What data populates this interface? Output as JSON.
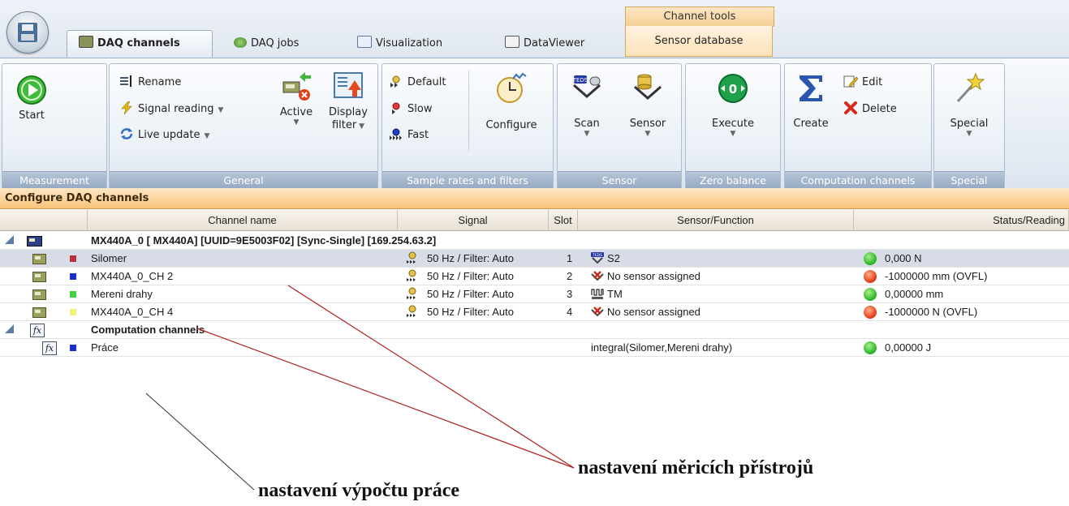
{
  "tabs": {
    "context_header": "Channel tools",
    "items": [
      {
        "label": "DAQ channels"
      },
      {
        "label": "DAQ jobs"
      },
      {
        "label": "Visualization"
      },
      {
        "label": "DataViewer"
      },
      {
        "label": "Sensor database"
      }
    ]
  },
  "ribbon": {
    "measurement": {
      "label": "Measurement",
      "start": "Start"
    },
    "general": {
      "label": "General",
      "rename": "Rename",
      "signal_reading": "Signal reading",
      "live_update": "Live update",
      "active": "Active",
      "display_filter_1": "Display",
      "display_filter_2": "filter"
    },
    "sample_rates": {
      "label": "Sample rates and filters",
      "default": "Default",
      "slow": "Slow",
      "fast": "Fast",
      "configure": "Configure"
    },
    "sensor": {
      "label": "Sensor",
      "scan": "Scan",
      "sensor": "Sensor"
    },
    "zero_balance": {
      "label": "Zero balance",
      "execute": "Execute"
    },
    "computation": {
      "label": "Computation channels",
      "create": "Create",
      "edit": "Edit",
      "delete": "Delete"
    },
    "special": {
      "label": "Special",
      "special": "Special"
    }
  },
  "section_title": "Configure DAQ channels",
  "columns": {
    "channel_name": "Channel name",
    "signal": "Signal",
    "slot": "Slot",
    "sensor_function": "Sensor/Function",
    "status": "Status/Reading"
  },
  "device_group": {
    "title": "MX440A_0   [ MX440A] [UUID=9E5003F02] [Sync-Single] [169.254.63.2]"
  },
  "channels": [
    {
      "name": "Silomer",
      "color": "#b8323c",
      "signal": "50 Hz / Filter: Auto",
      "slot": "1",
      "sensor_icon": "teds-icon",
      "sensor": "S2",
      "status": "ok",
      "reading": "0,000 N"
    },
    {
      "name": "MX440A_0_CH 2",
      "color": "#1e2fc8",
      "signal": "50 Hz / Filter: Auto",
      "slot": "2",
      "sensor_icon": "no-sensor-icon",
      "sensor": "No sensor assigned",
      "status": "overflow",
      "reading": "-1000000 mm (OVFL)"
    },
    {
      "name": "Mereni drahy",
      "color": "#3fd13f",
      "signal": "50 Hz / Filter: Auto",
      "slot": "3",
      "sensor_icon": "pulse-sensor-icon",
      "sensor": "TM",
      "status": "ok",
      "reading": "0,00000 mm"
    },
    {
      "name": "MX440A_0_CH 4",
      "color": "#f3f07a",
      "signal": "50 Hz / Filter: Auto",
      "slot": "4",
      "sensor_icon": "no-sensor-icon",
      "sensor": "No sensor assigned",
      "status": "overflow",
      "reading": "-1000000 N (OVFL)"
    }
  ],
  "computation_group": {
    "title": "Computation channels"
  },
  "computation_channels": [
    {
      "name": "Práce",
      "color": "#1e2fc8",
      "function": "integral(Silomer,Mereni drahy)",
      "status": "ok",
      "reading": "0,00000 J"
    }
  ],
  "annotations": {
    "instruments": "nastavení měricích přístrojů",
    "work": "nastavení výpočtu práce"
  }
}
